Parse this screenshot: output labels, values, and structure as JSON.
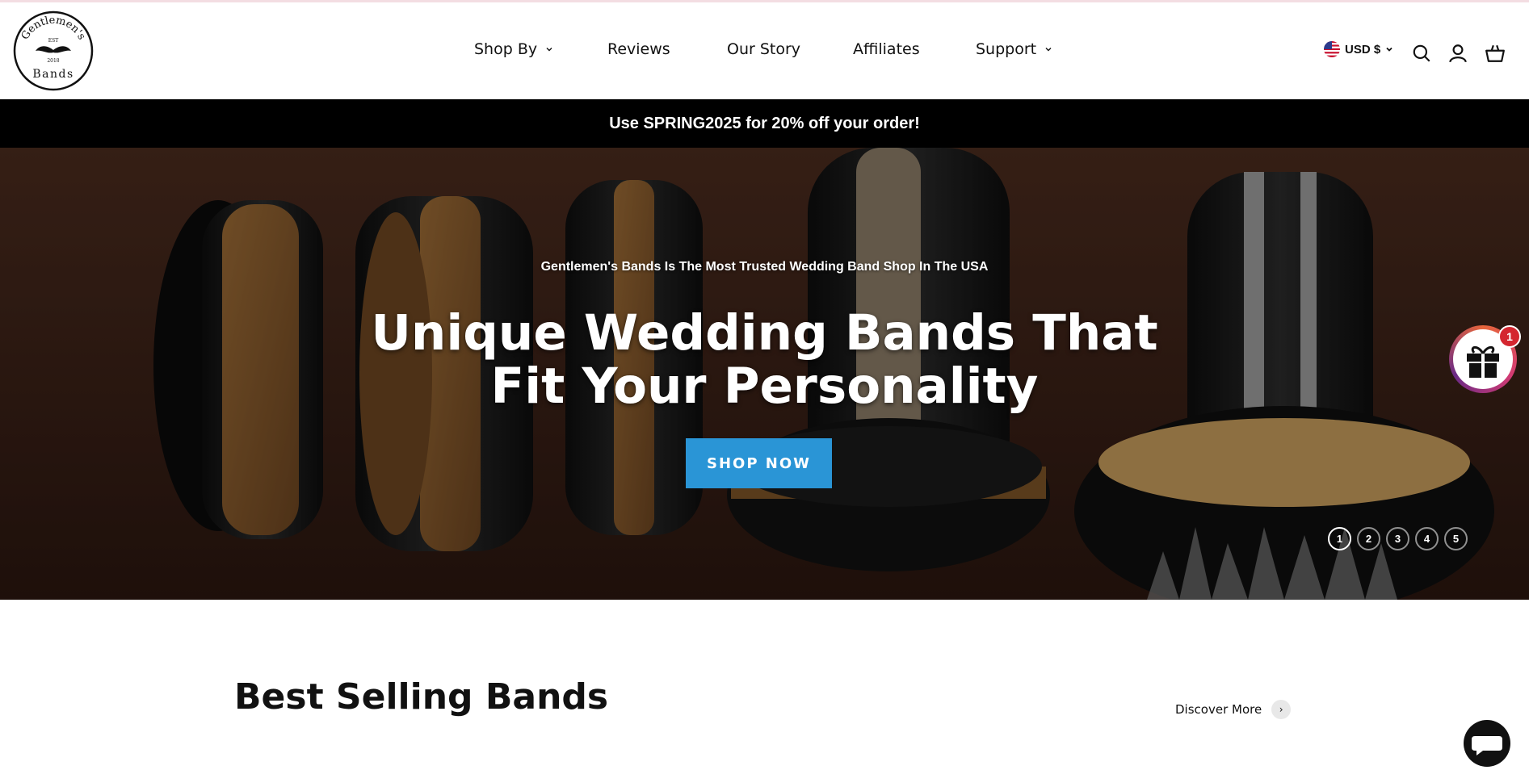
{
  "brand": {
    "logo_top": "Gentlemen's",
    "logo_est": "EST",
    "logo_year": "2018",
    "logo_bottom": "Bands"
  },
  "nav": {
    "items": [
      {
        "label": "Shop By",
        "has_menu": true
      },
      {
        "label": "Reviews",
        "has_menu": false
      },
      {
        "label": "Our Story",
        "has_menu": false
      },
      {
        "label": "Affiliates",
        "has_menu": false
      },
      {
        "label": "Support",
        "has_menu": true
      }
    ]
  },
  "header_utils": {
    "currency": "USD $",
    "icons": [
      "us-flag-icon",
      "search-icon",
      "account-icon",
      "cart-icon"
    ]
  },
  "promo": {
    "text": "Use SPRING2025 for 20% off your order!"
  },
  "hero": {
    "subtitle": "Gentlemen's Bands Is The Most Trusted Wedding Band Shop In The USA",
    "title_line1": "Unique Wedding Bands That",
    "title_line2": "Fit Your Personality",
    "cta": "SHOP NOW",
    "slides": [
      "1",
      "2",
      "3",
      "4",
      "5"
    ],
    "active_slide": "1"
  },
  "gift_widget": {
    "badge": "1"
  },
  "section": {
    "title": "Best Selling Bands",
    "discover": "Discover More"
  },
  "colors": {
    "accent": "#2a95d6",
    "promo_bg": "#000000",
    "badge": "#d4262f"
  }
}
